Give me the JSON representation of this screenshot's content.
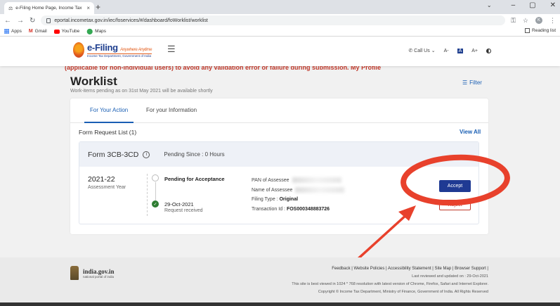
{
  "browser": {
    "tab_title": "e-Filing Home Page, Income Tax",
    "tab_close": "×",
    "new_tab": "+",
    "url": "eportal.incometax.gov.in/iec/foservices/#/dashboard/foWorklist/worklist",
    "profile_initial": "K",
    "bookmarks": [
      "Apps",
      "Gmail",
      "YouTube",
      "Maps"
    ],
    "reading_list": "Reading list"
  },
  "site": {
    "brand": "e-Filing",
    "tagline": "Anywhere Anytime",
    "dept": "Income Tax Department, Government of India",
    "call_us": "Call Us",
    "font_small": "A-",
    "font_normal": "A",
    "font_large": "A+",
    "banner_text": "(applicable for non-individual users) to avoid any validation error or failure during submission. My Profile"
  },
  "worklist": {
    "title": "Worklist",
    "subtitle": "Work-items pending as on 31st May 2021 will be available shortly",
    "filter_label": "Filter",
    "tabs": [
      "For Your Action",
      "For your Information"
    ],
    "list_title": "Form Request List (1)",
    "view_all": "View All",
    "request": {
      "form": "Form 3CB-3CD",
      "pending_since": "Pending Since : 0 Hours",
      "year": "2021-22",
      "year_label": "Assessment Year",
      "status_pending": "Pending for Acceptance",
      "status_date": "29-Oct-2021",
      "status_received": "Request received",
      "pan_label": "PAN of Assessee",
      "name_label": "Name of Assessee",
      "filing_type_label": "Filing Type :",
      "filing_type": "Original",
      "txn_label": "Transaction Id :",
      "txn_id": "FOS000348883726",
      "accept": "Accept",
      "reject": "Reject"
    }
  },
  "footer": {
    "gov_title": "india.gov.in",
    "gov_sub": "national portal of india",
    "links": "Feedback | Website Policies | Accessibility Statement | Site Map | Browser Support |",
    "last_reviewed": "Last reviewed and updated on : 29-Oct-2021",
    "best_viewed": "This site is best viewed in 1024 * 768 resolution with latest version of Chrome, Firefox, Safari and Internet Explorer.",
    "copyright": "Copyright © Income Tax Department, Ministry of Finance, Government of India. All Rights Reserved"
  },
  "colors": {
    "primary": "#1f3a93",
    "link": "#1a5fb4",
    "annotation": "#e8412c"
  }
}
